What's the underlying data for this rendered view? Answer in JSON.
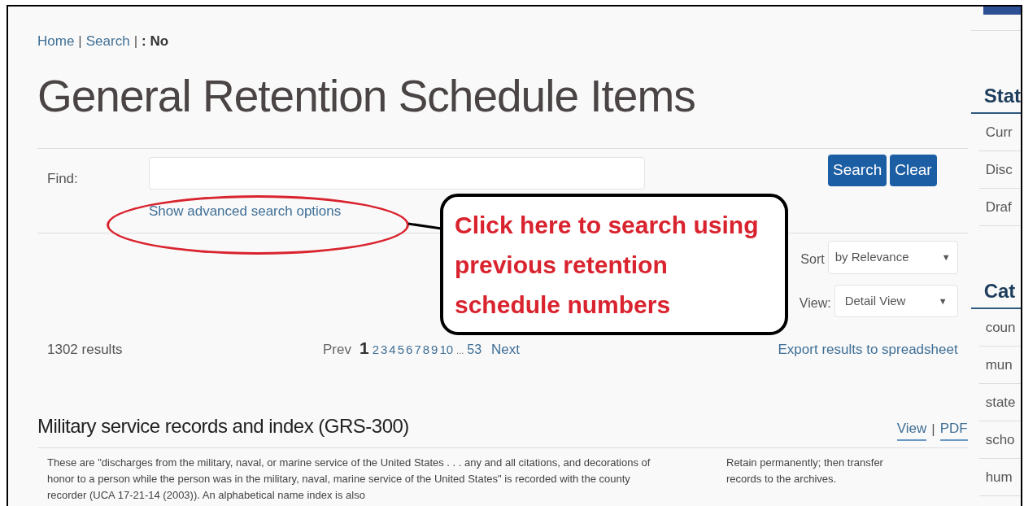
{
  "breadcrumb": {
    "links": [
      "Home",
      "Search"
    ],
    "separator": "|",
    "current": ": No"
  },
  "title": "General Retention Schedule Items",
  "find": {
    "label": "Find:",
    "search_button": "Search",
    "clear_button": "Clear",
    "advanced_link": "Show advanced search options"
  },
  "sort": {
    "label": "Sort",
    "value": "by Relevance",
    "caret": "▼"
  },
  "view": {
    "label": "View:",
    "value": "Detail View",
    "caret": "▼"
  },
  "results": {
    "count": "1302 results",
    "prev": "Prev",
    "next": "Next",
    "export": "Export results to spreadsheet",
    "pages": [
      {
        "label": "1",
        "selected": true
      },
      {
        "label": "2",
        "selected": false
      },
      {
        "label": "3",
        "selected": false
      },
      {
        "label": "4",
        "selected": false
      },
      {
        "label": "5",
        "selected": false
      },
      {
        "label": "6",
        "selected": false
      },
      {
        "label": "7",
        "selected": false
      },
      {
        "label": "8",
        "selected": false
      },
      {
        "label": "9",
        "selected": false
      },
      {
        "label": "10",
        "selected": false
      }
    ],
    "ellipsis": "...",
    "last_page": "53"
  },
  "item": {
    "title": "Military service records and index (GRS-300)",
    "view_link": "View",
    "separator": "|",
    "pdf_link": "PDF",
    "description": "These are \"discharges from the military, naval, or marine service of the United States . . . any and all citations, and decorations of honor to a person while the person was in the military, naval, marine service of the United States\" is recorded with the county recorder (UCA 17-21-14 (2003)). An alphabetical name index is also",
    "retention": "Retain permanently; then transfer records to the archives."
  },
  "sidebar": [
    {
      "heading": "Stat",
      "items": [
        "Curr",
        "Disc",
        "Draf"
      ]
    },
    {
      "heading": "Cat",
      "items": [
        "coun",
        "mun",
        "state",
        "scho",
        "hum"
      ]
    }
  ],
  "callout": {
    "lines": [
      "Click here to search using",
      "previous retention",
      "schedule numbers"
    ]
  }
}
